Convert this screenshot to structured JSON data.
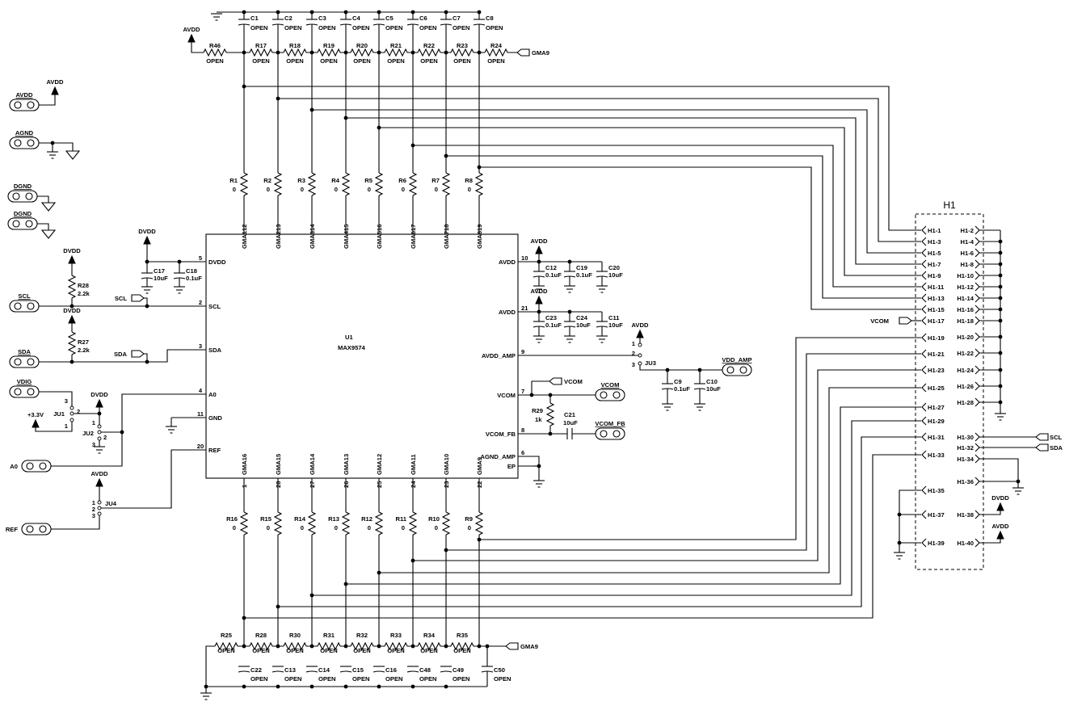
{
  "top": {
    "power": "AVDD",
    "net_flag": "GMA9",
    "ground_caps": [
      {
        "ref": "C1",
        "value": "OPEN"
      },
      {
        "ref": "C2",
        "value": "OPEN"
      },
      {
        "ref": "C3",
        "value": "OPEN"
      },
      {
        "ref": "C4",
        "value": "OPEN"
      },
      {
        "ref": "C5",
        "value": "OPEN"
      },
      {
        "ref": "C6",
        "value": "OPEN"
      },
      {
        "ref": "C7",
        "value": "OPEN"
      },
      {
        "ref": "C8",
        "value": "OPEN"
      }
    ],
    "series_resistors": [
      {
        "ref": "R46",
        "value": "OPEN"
      },
      {
        "ref": "R17",
        "value": "OPEN"
      },
      {
        "ref": "R18",
        "value": "OPEN"
      },
      {
        "ref": "R19",
        "value": "OPEN"
      },
      {
        "ref": "R20",
        "value": "OPEN"
      },
      {
        "ref": "R21",
        "value": "OPEN"
      },
      {
        "ref": "R22",
        "value": "OPEN"
      },
      {
        "ref": "R23",
        "value": "OPEN"
      },
      {
        "ref": "R24",
        "value": "OPEN"
      }
    ]
  },
  "gma_top": [
    {
      "ref": "R1",
      "value": "0",
      "pin": "12",
      "net": "GMA1"
    },
    {
      "ref": "R2",
      "value": "0",
      "pin": "13",
      "net": "GMA2"
    },
    {
      "ref": "R3",
      "value": "0",
      "pin": "14",
      "net": "GMA3"
    },
    {
      "ref": "R4",
      "value": "0",
      "pin": "15",
      "net": "GMA4"
    },
    {
      "ref": "R5",
      "value": "0",
      "pin": "16",
      "net": "GMA5"
    },
    {
      "ref": "R6",
      "value": "0",
      "pin": "17",
      "net": "GMA6"
    },
    {
      "ref": "R7",
      "value": "0",
      "pin": "18",
      "net": "GMA7"
    },
    {
      "ref": "R8",
      "value": "0",
      "pin": "19",
      "net": "GMA8"
    }
  ],
  "gma_bottom": [
    {
      "ref": "R16",
      "value": "0",
      "pin": "1",
      "net": "GMA16"
    },
    {
      "ref": "R15",
      "value": "0",
      "pin": "28",
      "net": "GMA15"
    },
    {
      "ref": "R14",
      "value": "0",
      "pin": "27",
      "net": "GMA14"
    },
    {
      "ref": "R13",
      "value": "0",
      "pin": "26",
      "net": "GMA13"
    },
    {
      "ref": "R12",
      "value": "0",
      "pin": "25",
      "net": "GMA12"
    },
    {
      "ref": "R11",
      "value": "0",
      "pin": "24",
      "net": "GMA11"
    },
    {
      "ref": "R10",
      "value": "0",
      "pin": "23",
      "net": "GMA10"
    },
    {
      "ref": "R9",
      "value": "0",
      "pin": "22",
      "net": "GMA9"
    }
  ],
  "bottom": {
    "net_flag": "GMA9",
    "series_resistors": [
      {
        "ref": "R25",
        "value": "OPEN"
      },
      {
        "ref": "R28",
        "value": "OPEN"
      },
      {
        "ref": "R30",
        "value": "OPEN"
      },
      {
        "ref": "R31",
        "value": "OPEN"
      },
      {
        "ref": "R32",
        "value": "OPEN"
      },
      {
        "ref": "R33",
        "value": "OPEN"
      },
      {
        "ref": "R34",
        "value": "OPEN"
      },
      {
        "ref": "R35",
        "value": "OPEN"
      }
    ],
    "ground_caps": [
      {
        "ref": "C22",
        "value": "OPEN"
      },
      {
        "ref": "C13",
        "value": "OPEN"
      },
      {
        "ref": "C14",
        "value": "OPEN"
      },
      {
        "ref": "C15",
        "value": "OPEN"
      },
      {
        "ref": "C16",
        "value": "OPEN"
      },
      {
        "ref": "C48",
        "value": "OPEN"
      },
      {
        "ref": "C49",
        "value": "OPEN"
      },
      {
        "ref": "C50",
        "value": "OPEN"
      }
    ]
  },
  "chip": {
    "ref": "U1",
    "part": "MAX9574",
    "left_pins": [
      {
        "num": "5",
        "name": "DVDD"
      },
      {
        "num": "2",
        "name": "SCL"
      },
      {
        "num": "3",
        "name": "SDA"
      },
      {
        "num": "4",
        "name": "A0"
      },
      {
        "num": "11",
        "name": "GND"
      },
      {
        "num": "20",
        "name": "REF"
      }
    ],
    "right_pins": [
      {
        "num": "10",
        "name": "AVDD"
      },
      {
        "num": "21",
        "name": "AVDD"
      },
      {
        "num": "9",
        "name": "AVDD_AMP"
      },
      {
        "num": "7",
        "name": "VCOM"
      },
      {
        "num": "8",
        "name": "VCOM_FB"
      },
      {
        "num": "6",
        "name": "AGND_AMP"
      },
      {
        "num": "",
        "name": "EP"
      }
    ]
  },
  "left": {
    "pads": {
      "avdd": "AVDD",
      "agnd": "AGND",
      "dgnd1": "DGND",
      "dgnd2": "DGND",
      "scl": "SCL",
      "sda": "SDA",
      "vdig": "VDIG",
      "a0": "A0",
      "ref": "REF"
    },
    "avdd_power": "AVDD",
    "r28": {
      "ref": "R28",
      "value": "2.2k",
      "power": "DVDD"
    },
    "r27": {
      "ref": "R27",
      "value": "2.2k",
      "power": "DVDD"
    },
    "scl_flag": "SCL",
    "sda_flag": "SDA",
    "dvdd_power": "DVDD",
    "c17": {
      "ref": "C17",
      "value": "10uF"
    },
    "c18": {
      "ref": "C18",
      "value": "0.1uF"
    },
    "ju1": {
      "ref": "JU1",
      "p1": "1",
      "p2": "2",
      "p3": "3",
      "power": "+3.3V"
    },
    "ju2": {
      "ref": "JU2",
      "p1": "1",
      "p2": "2",
      "p3": "3",
      "power": "DVDD"
    },
    "ju4": {
      "ref": "JU4",
      "p1": "1",
      "p2": "2",
      "p3": "3",
      "power": "AVDD"
    }
  },
  "right": {
    "avdd1_power": "AVDD",
    "c12": {
      "ref": "C12",
      "value": "0.1uF"
    },
    "c19": {
      "ref": "C19",
      "value": "0.1uF"
    },
    "c20": {
      "ref": "C20",
      "value": "10uF"
    },
    "avdd2_power": "AVDD",
    "c23": {
      "ref": "C23",
      "value": "0.1uF"
    },
    "c24": {
      "ref": "C24",
      "value": "10uF"
    },
    "c11": {
      "ref": "C11",
      "value": "10uF"
    },
    "ju3": {
      "ref": "JU3",
      "p1": "1",
      "p2": "2",
      "p3": "3",
      "power": "AVDD"
    },
    "c9": {
      "ref": "C9",
      "value": "0.1uF"
    },
    "c10": {
      "ref": "C10",
      "value": "10uF"
    },
    "vdd_amp_pad": "VDD_AMP",
    "vcom_flag": "VCOM",
    "vcom_pad": "VCOM",
    "vcom_fb_pad": "VCOM_FB",
    "r29": {
      "ref": "R29",
      "value": "1k"
    },
    "c21": {
      "ref": "C21",
      "value": "10uF"
    }
  },
  "header": {
    "ref": "H1",
    "left_pins": [
      "H1-1",
      "H1-3",
      "H1-5",
      "H1-7",
      "H1-9",
      "H1-11",
      "H1-13",
      "H1-15",
      "H1-17",
      "H1-19",
      "H1-21",
      "H1-23",
      "H1-25",
      "H1-27",
      "H1-29",
      "H1-31",
      "H1-33",
      "H1-35",
      "H1-37",
      "H1-39"
    ],
    "right_pins": [
      "H1-2",
      "H1-4",
      "H1-6",
      "H1-8",
      "H1-10",
      "H1-12",
      "H1-14",
      "H1-16",
      "H1-18",
      "H1-20",
      "H1-22",
      "H1-24",
      "H1-26",
      "H1-28",
      "H1-30",
      "H1-32",
      "H1-34",
      "H1-36",
      "H1-38",
      "H1-40"
    ],
    "vcom_flag": "VCOM",
    "scl_flag": "SCL",
    "sda_flag": "SDA",
    "dvdd_power": "DVDD",
    "avdd_power": "AVDD"
  }
}
